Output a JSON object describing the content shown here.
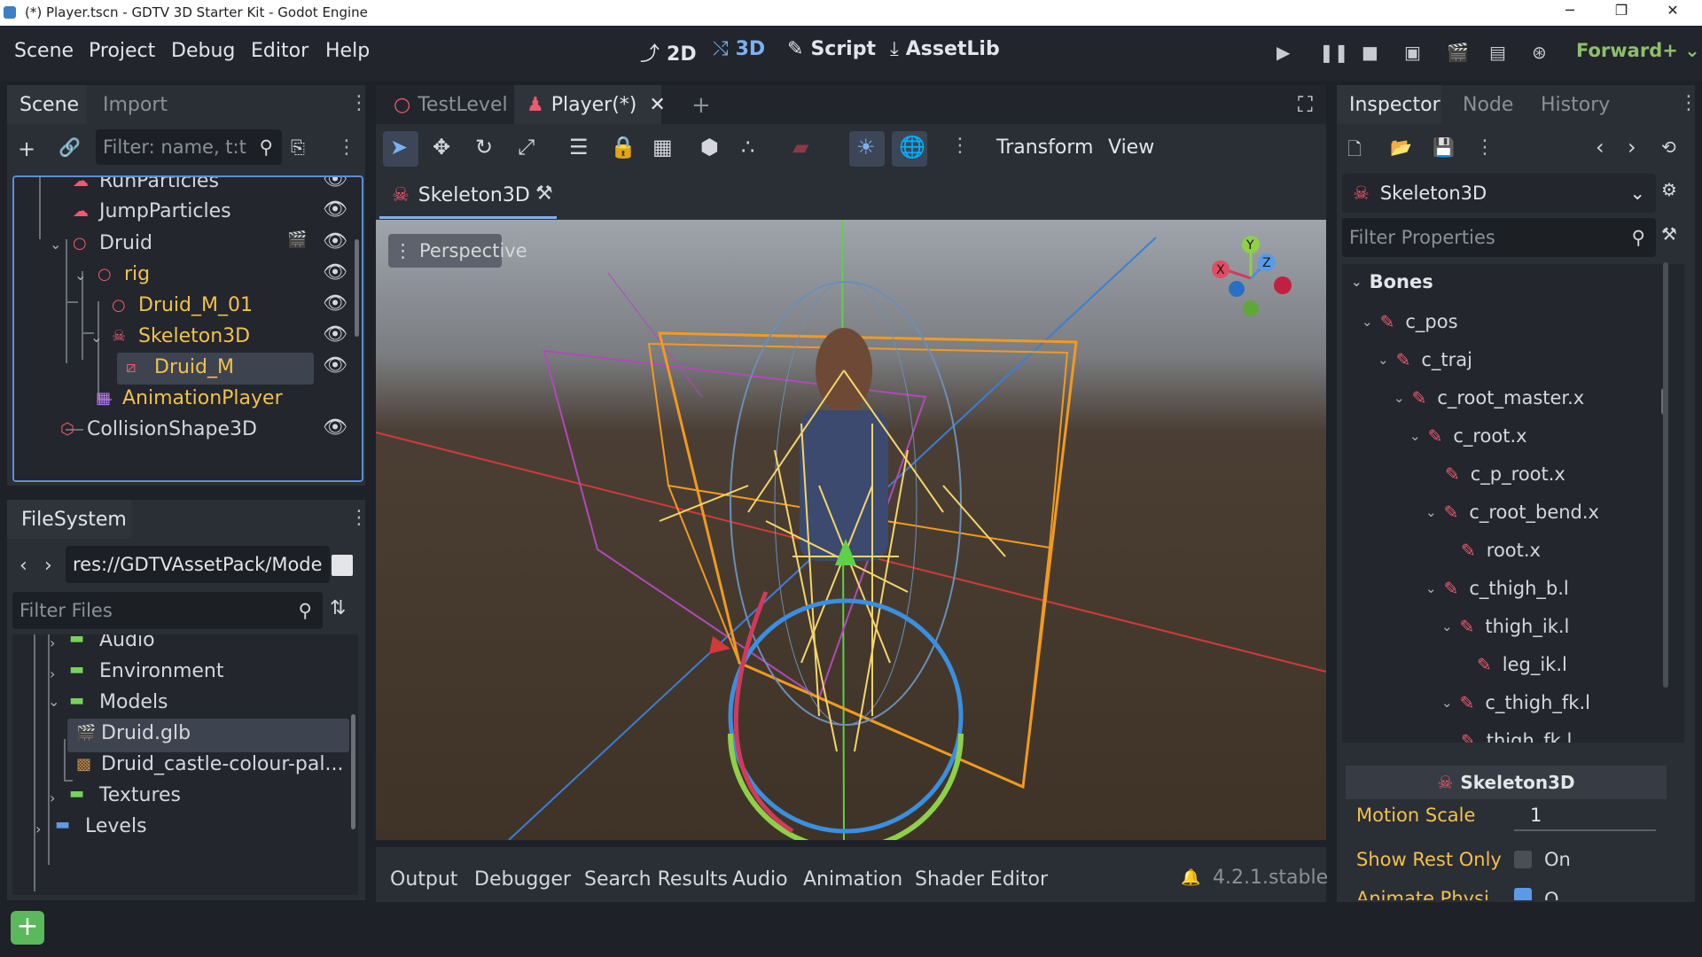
{
  "window": {
    "title": "(*) Player.tscn - GDTV 3D Starter Kit - Godot Engine",
    "minimize": "─",
    "restore": "❐",
    "close": "✕"
  },
  "menu": [
    "Scene",
    "Project",
    "Debug",
    "Editor",
    "Help"
  ],
  "workspaces": [
    {
      "icon": "⤴",
      "label": "2D"
    },
    {
      "icon": "⤭",
      "label": "3D"
    },
    {
      "icon": "✎",
      "label": "Script"
    },
    {
      "icon": "⤓",
      "label": "AssetLib"
    }
  ],
  "renderer": "Forward+",
  "scene_dock": {
    "tabs": [
      "Scene",
      "Import"
    ],
    "filter_placeholder": "Filter: name, t:t",
    "nodes": [
      {
        "label": "RunParticles",
        "color": "#e3e5e9"
      },
      {
        "label": "JumpParticles",
        "color": "#e3e5e9"
      },
      {
        "label": "Druid",
        "color": "#e3e5e9"
      },
      {
        "label": "rig",
        "color": "#f2c14e"
      },
      {
        "label": "Druid_M_01",
        "color": "#f2c14e"
      },
      {
        "label": "Skeleton3D",
        "color": "#f2c14e"
      },
      {
        "label": "Druid_M",
        "color": "#f2c14e"
      },
      {
        "label": "AnimationPlayer",
        "color": "#f2c14e"
      },
      {
        "label": "CollisionShape3D",
        "color": "#e3e5e9"
      }
    ]
  },
  "filesystem": {
    "tab": "FileSystem",
    "path": "res://GDTVAssetPack/Mode",
    "filter_placeholder": "Filter Files",
    "items": [
      {
        "label": "Audio"
      },
      {
        "label": "Environment"
      },
      {
        "label": "Models"
      },
      {
        "label": "Druid.glb"
      },
      {
        "label": "Druid_castle-colour-pal..."
      },
      {
        "label": "Textures"
      },
      {
        "label": "Levels"
      }
    ]
  },
  "editor_tabs": [
    {
      "label": "TestLevel"
    },
    {
      "label": "Player(*)"
    }
  ],
  "viewport_toolbar": {
    "transform": "Transform",
    "view": "View"
  },
  "viewport": {
    "breadcrumb": "Skeleton3D",
    "perspective": "Perspective",
    "gizmo": {
      "x": "X",
      "y": "Y",
      "z": "Z"
    }
  },
  "inspector": {
    "tabs": [
      "Inspector",
      "Node",
      "History"
    ],
    "object": "Skeleton3D",
    "filter_placeholder": "Filter Properties",
    "section": "Bones",
    "bones": [
      {
        "label": "c_pos"
      },
      {
        "label": "c_traj"
      },
      {
        "label": "c_root_master.x"
      },
      {
        "label": "c_root.x"
      },
      {
        "label": "c_p_root.x"
      },
      {
        "label": "c_root_bend.x"
      },
      {
        "label": "root.x"
      },
      {
        "label": "c_thigh_b.l"
      },
      {
        "label": "thigh_ik.l"
      },
      {
        "label": "leg_ik.l"
      },
      {
        "label": "c_thigh_fk.l"
      },
      {
        "label": "thigh_fk.l"
      }
    ],
    "category": "Skeleton3D",
    "properties": [
      {
        "label": "Motion Scale",
        "value": "1"
      },
      {
        "label": "Show Rest Only",
        "value": "On"
      },
      {
        "label": "Animate Physi...",
        "value": "O..."
      }
    ]
  },
  "bottom_panel": {
    "tabs": [
      "Output",
      "Debugger",
      "Search Results",
      "Audio",
      "Animation",
      "Shader Editor"
    ],
    "version": "4.2.1.stable"
  },
  "colors": {
    "accent": "#7cb1f3",
    "script_node": "#f2c14e",
    "bone": "#ef5a6f",
    "folder": "#78d35a",
    "renderer": "#8dc06a"
  }
}
